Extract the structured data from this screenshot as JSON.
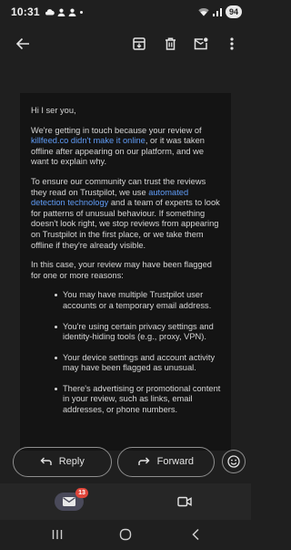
{
  "status_bar": {
    "time": "10:31",
    "left_icons": [
      "cloud-icon",
      "person-icon",
      "person-icon",
      "dot-icon"
    ],
    "right_icons": [
      "wifi-icon",
      "signal-icon"
    ],
    "battery": "94"
  },
  "app_bar": {
    "icons": [
      "back-arrow-icon",
      "archive-icon",
      "delete-icon",
      "mark-unread-icon",
      "more-vert-icon"
    ]
  },
  "email": {
    "greeting": "Hi I ser you,",
    "p1_before": "We're getting in touch because your review of ",
    "p1_link": "killfeed.co didn't make it online",
    "p1_after": ", or it was taken offline after appearing on our platform, and we want to explain why.",
    "p2_before": "To ensure our community can trust the reviews they read on Trustpilot, we use ",
    "p2_link": "automated detection technology",
    "p2_after": " and a team of experts to look for patterns of unusual behaviour. If something doesn't look right, we stop reviews from appearing on Trustpilot in the first place, or we take them offline if they're already visible.",
    "p3": "In this case, your review may have been flagged for one or more reasons:",
    "bullets": [
      "You may have multiple Trustpilot user accounts or a temporary email address.",
      "You're using certain privacy settings and identity-hiding tools (e.g., proxy, VPN).",
      "Your device settings and account activity may have been flagged as unusual.",
      "There's advertising or promotional content in your review, such as links, email addresses, or phone numbers."
    ]
  },
  "actions": {
    "reply_label": "Reply",
    "forward_label": "Forward",
    "emoji_icon": "emoji-icon"
  },
  "bottom_nav": {
    "mail_badge": "13",
    "items": [
      "mail-icon",
      "video-camera-icon"
    ]
  },
  "system_nav": [
    "recents-icon",
    "home-icon",
    "back-icon"
  ],
  "colors": {
    "background": "#1f1f1f",
    "card": "#141414",
    "link": "#5f9bf5",
    "badge": "#e0463a"
  }
}
